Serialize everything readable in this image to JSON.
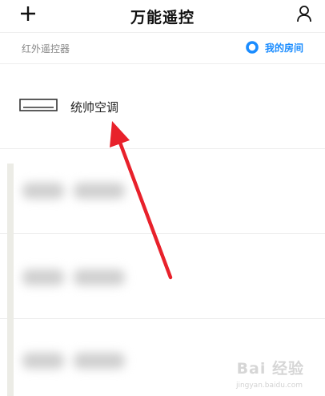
{
  "header": {
    "title": "万能遥控",
    "add_icon": "plus-icon",
    "user_icon": "user-icon"
  },
  "subheader": {
    "section_label": "红外遥控器",
    "room_label": "我的房间",
    "room_icon": "ring-icon",
    "accent_color": "#1a8cff"
  },
  "devices": [
    {
      "name": "统帅空调",
      "icon": "air-conditioner-icon"
    }
  ],
  "watermark": {
    "text": "Bai 经验",
    "sub": "jingyan.baidu.com"
  },
  "annotation": {
    "arrow_color": "#e8212b"
  }
}
